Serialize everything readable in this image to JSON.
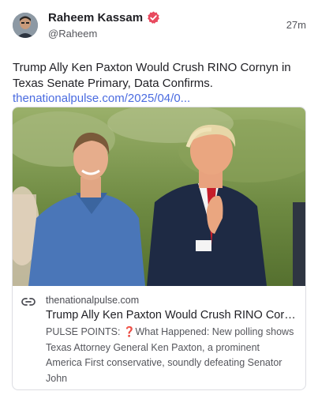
{
  "post": {
    "author": {
      "display_name": "Raheem Kassam",
      "handle": "@Raheem",
      "verified": true,
      "avatar_icon": "profile-photo"
    },
    "time": "27m",
    "text": "Trump Ally Ken Paxton Would Crush RINO Cornyn in Texas Senate Primary, Data Confirms.",
    "link_text": "thenationalpulse.com/2025/04/0..."
  },
  "link_card": {
    "image_icon": "news-photo",
    "domain": "thenationalpulse.com",
    "title": "Trump Ally Ken Paxton Would Crush RINO Corn...",
    "description": "PULSE POINTS: ❓What Happened: New polling shows Texas Attorney General Ken Paxton, a prominent America First conservative, soundly defeating Senator John",
    "icon": "link-icon"
  },
  "colors": {
    "verified_badge": "#e84a5f",
    "link": "#4a6be0",
    "card_border": "#dcdde2"
  }
}
